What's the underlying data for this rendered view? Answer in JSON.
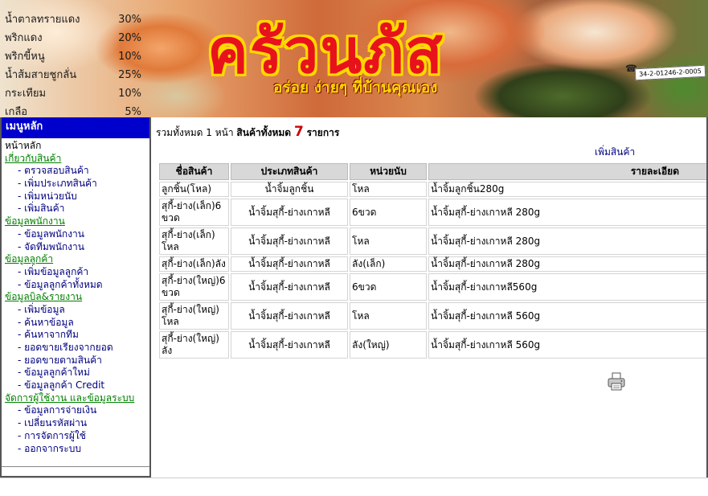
{
  "banner": {
    "ingredients": [
      {
        "name": "น้ำตาลทรายแดง",
        "pct": "30%"
      },
      {
        "name": "พริกแดง",
        "pct": "20%"
      },
      {
        "name": "พริกขี้หนู",
        "pct": "10%"
      },
      {
        "name": "น้ำส้มสายชูกลั่น",
        "pct": "25%"
      },
      {
        "name": "กระเทียม",
        "pct": "10%"
      },
      {
        "name": "เกลือ",
        "pct": "5%"
      }
    ],
    "logo_title": "ครัวนภัส",
    "logo_slogan": "อร่อย ง่ายๆ ที่บ้านคุณเอง",
    "phone": "34-2-01246-2-0005"
  },
  "sidebar": {
    "title": "เมนูหลัก",
    "items": [
      {
        "label": "หน้าหลัก",
        "kind": "home"
      },
      {
        "label": "เกี่ยวกับสินค้า",
        "kind": "section"
      },
      {
        "label": "- ตรวจสอบสินค้า",
        "kind": "sub"
      },
      {
        "label": "- เพิ่มประเภทสินค้า",
        "kind": "sub"
      },
      {
        "label": "- เพิ่มหน่วยนับ",
        "kind": "sub"
      },
      {
        "label": "- เพิ่มสินค้า",
        "kind": "sub"
      },
      {
        "label": "ข้อมูลพนักงาน",
        "kind": "section"
      },
      {
        "label": "- ข้อมูลพนักงาน",
        "kind": "sub"
      },
      {
        "label": "- จัดทีมพนักงาน",
        "kind": "sub"
      },
      {
        "label": "ข้อมูลลูกค้า",
        "kind": "section"
      },
      {
        "label": "- เพิ่มข้อมูลลูกค้า",
        "kind": "sub"
      },
      {
        "label": "- ข้อมูลลูกค้าทั้งหมด",
        "kind": "sub"
      },
      {
        "label": "ข้อมูลบิล&รายงาน",
        "kind": "section"
      },
      {
        "label": "- เพิ่มข้อมูล",
        "kind": "sub"
      },
      {
        "label": "- ค้นหาข้อมูล",
        "kind": "sub"
      },
      {
        "label": "- ค้นหาจากทีม",
        "kind": "sub"
      },
      {
        "label": "- ยอดขายเรียงจากยอด",
        "kind": "sub"
      },
      {
        "label": "- ยอดขายตามสินค้า",
        "kind": "sub"
      },
      {
        "label": "- ข้อมูลลูกค้าใหม่",
        "kind": "sub"
      },
      {
        "label": "- ข้อมูลลูกค้า Credit",
        "kind": "sub"
      },
      {
        "label": "จัดการผู้ใช้งาน และข้อมูลระบบ",
        "kind": "section"
      },
      {
        "label": "- ข้อมูลการจ่ายเงิน",
        "kind": "sub"
      },
      {
        "label": "- เปลี่ยนรหัสผ่าน",
        "kind": "sub"
      },
      {
        "label": "- การจัดการผู้ใช้",
        "kind": "sub"
      },
      {
        "label": "- ออกจากระบบ",
        "kind": "sub"
      }
    ]
  },
  "main": {
    "summary_prefix": "รวมทั้งหมด 1 หน้า",
    "summary_all": "สินค้าทั้งหมด",
    "summary_count": "7",
    "summary_unit": "รายการ",
    "add_product_label": "เพิ่มสินค้า",
    "columns": [
      "ชื่อสินค้า",
      "ประเภทสินค้า",
      "หน่วยนับ",
      "รายละเอียด"
    ],
    "rows": [
      [
        "ลูกชิ้น(โหล)",
        "น้ำจิ้มลูกชิ้น",
        "โหล",
        "น้ำจิ้มลูกชิ้น280g"
      ],
      [
        "สุกี้-ย่าง(เล็ก)6 ขวด",
        "น้ำจิ้มสุกี้-ย่างเกาหลี",
        "6ขวด",
        "น้ำจิ้มสุกี้-ย่างเกาหลี 280g"
      ],
      [
        "สุกี้-ย่าง(เล็ก) โหล",
        "น้ำจิ้มสุกี้-ย่างเกาหลี",
        "โหล",
        "น้ำจิ้มสุกี้-ย่างเกาหลี 280g"
      ],
      [
        "สุกี้-ย่าง(เล็ก)ลัง",
        "น้ำจิ้มสุกี้-ย่างเกาหลี",
        "ลัง(เล็ก)",
        "น้ำจิ้มสุกี้-ย่างเกาหลี 280g"
      ],
      [
        "สุกี้-ย่าง(ใหญ่)6 ขวด",
        "น้ำจิ้มสุกี้-ย่างเกาหลี",
        "6ขวด",
        "น้ำจิ้มสุกี้-ย่างเกาหลี560g"
      ],
      [
        "สุกี้-ย่าง(ใหญ่) โหล",
        "น้ำจิ้มสุกี้-ย่างเกาหลี",
        "โหล",
        "น้ำจิ้มสุกี้-ย่างเกาหลี 560g"
      ],
      [
        "สุกี้-ย่าง(ใหญ่) ลัง",
        "น้ำจิ้มสุกี้-ย่างเกาหลี",
        "ลัง(ใหญ่)",
        "น้ำจิ้มสุกี้-ย่างเกาหลี 560g"
      ]
    ],
    "print_icon": "printer-icon"
  }
}
